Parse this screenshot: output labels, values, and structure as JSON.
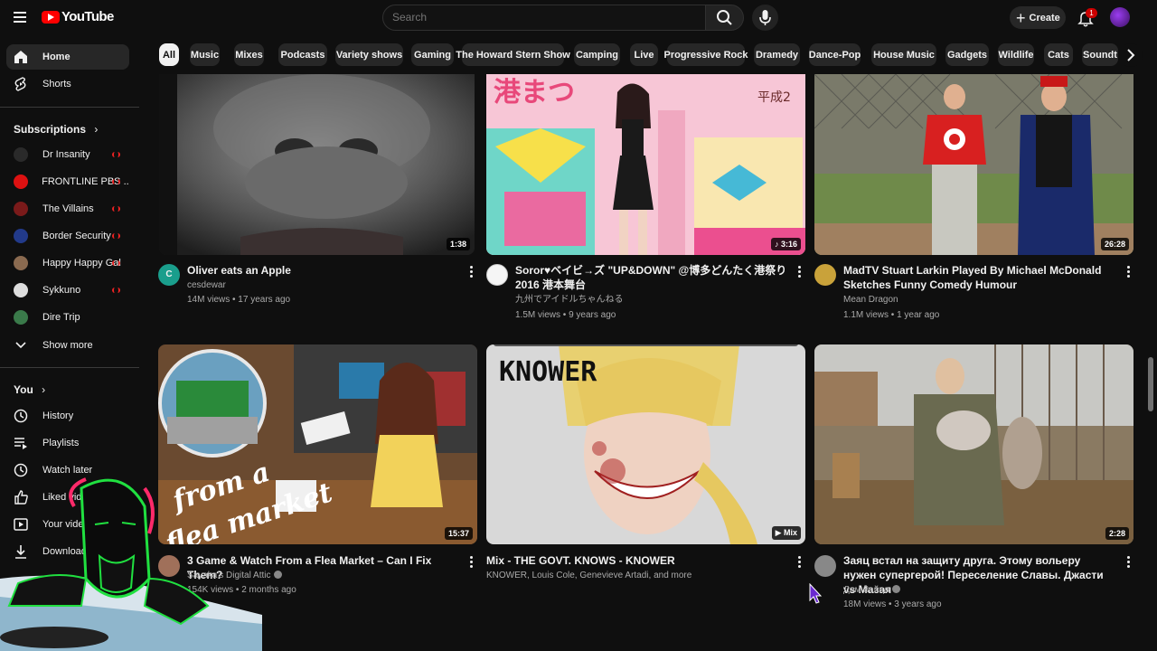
{
  "app": {
    "logo_text": "YouTube"
  },
  "header": {
    "search_placeholder": "Search",
    "create_label": "Create",
    "notification_count": "1"
  },
  "sidebar": {
    "primary": [
      {
        "label": "Home",
        "icon": "home-icon"
      },
      {
        "label": "Shorts",
        "icon": "shorts-icon"
      }
    ],
    "subscriptions_heading": "Subscriptions",
    "subscriptions": [
      {
        "label": "Dr Insanity",
        "color": "#2a2a2a",
        "live": true
      },
      {
        "label": "FRONTLINE PBS ...",
        "color": "#d11",
        "live": true
      },
      {
        "label": "The Villains",
        "color": "#7a1a1a",
        "live": true
      },
      {
        "label": "Border Security",
        "color": "#223a8a",
        "live": true
      },
      {
        "label": "Happy Happy Gal",
        "color": "#8a6a50",
        "live": true
      },
      {
        "label": "Sykkuno",
        "color": "#dddddd",
        "live": true
      },
      {
        "label": "Dire Trip",
        "color": "#3a7a4a",
        "live": false
      }
    ],
    "show_more": "Show more",
    "you_heading": "You",
    "you_items": [
      {
        "label": "History",
        "icon": "history-icon"
      },
      {
        "label": "Playlists",
        "icon": "playlists-icon"
      },
      {
        "label": "Watch later",
        "icon": "watch-later-icon"
      },
      {
        "label": "Liked videos",
        "icon": "like-icon"
      },
      {
        "label": "Your videos",
        "icon": "your-videos-icon"
      },
      {
        "label": "Downloads",
        "icon": "download-icon"
      }
    ]
  },
  "chips": [
    "All",
    "Music",
    "Mixes",
    "Podcasts",
    "Variety shows",
    "Gaming",
    "The Howard Stern Show",
    "Camping",
    "Live",
    "Progressive Rock",
    "Dramedy",
    "Dance-Pop",
    "House Music",
    "Gadgets",
    "Wildlife",
    "Cats",
    "Soundt"
  ],
  "videos": [
    {
      "title": "Oliver eats an Apple",
      "channel": "cesdewar",
      "stats": "14M views • 17 years ago",
      "duration": "1:38",
      "avatar_letter": "C",
      "avatar_color": "#1a9e8c"
    },
    {
      "title": "Soror♥ベイビ→ズ \"UP&DOWN\" @博多どんたく港祭り2016 港本舞台",
      "channel": "九州でアイドルちゃんねる",
      "stats": "1.5M views • 9 years ago",
      "duration": "3:16",
      "avatar_color": "#f5f5f5"
    },
    {
      "title": "MadTV Stuart Larkin Played By Michael McDonald Sketches Funny Comedy Humour",
      "channel": "Mean Dragon",
      "stats": "1.1M views • 1 year ago",
      "duration": "26:28",
      "avatar_color": "#c9a23a"
    },
    {
      "title": "3 Game & Watch From a Flea Market – Can I Fix Them?",
      "channel": "Sayaka's Digital Attic",
      "stats": "154K views • 2 months ago",
      "duration": "15:37",
      "avatar_color": "#a0705a",
      "verified": true
    },
    {
      "title": "Mix - THE GOVT. KNOWS - KNOWER",
      "channel": "KNOWER, Louis Cole, Genevieve Artadi, and more",
      "stats": "",
      "duration": "Mix"
    },
    {
      "title": "Заяц встал на защиту друга. Этому вольеру нужен супергерой! Переселение Славы. Джасти vs Мазая",
      "channel": "Дом Зайца",
      "stats": "18M views • 3 years ago",
      "duration": "2:28",
      "avatar_color": "#888888",
      "verified": true
    }
  ],
  "thumb_text": {
    "knower": "KNOWER",
    "flea": "from a flea market"
  }
}
